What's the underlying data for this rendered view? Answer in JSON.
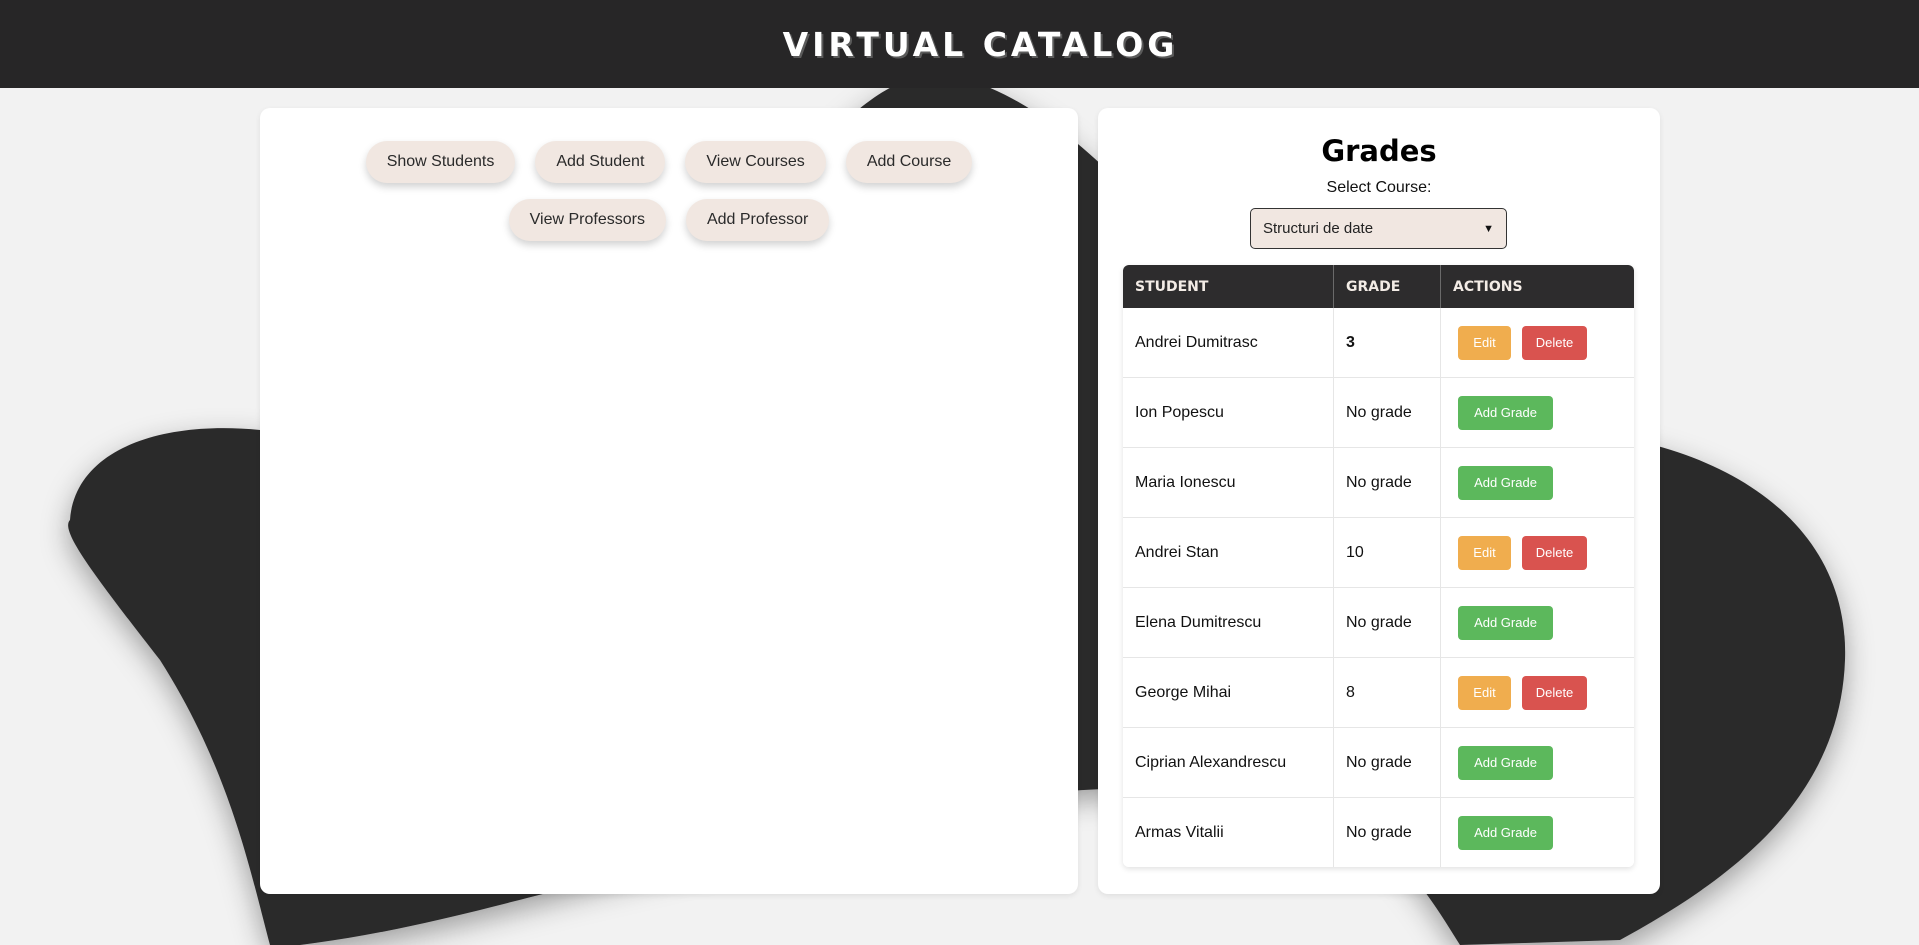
{
  "header": {
    "title": "VIRTUAL CATALOG"
  },
  "nav": {
    "row1": [
      "Show Students",
      "Add Student",
      "View Courses",
      "Add Course"
    ],
    "row2": [
      "View Professors",
      "Add Professor"
    ]
  },
  "grades": {
    "title": "Grades",
    "select_label": "Select Course:",
    "selected_course": "Structuri de date",
    "columns": [
      "STUDENT",
      "GRADE",
      "ACTIONS"
    ],
    "rows": [
      {
        "student": "Andrei Dumitrasc",
        "grade": "3",
        "actions": [
          "Edit",
          "Delete"
        ]
      },
      {
        "student": "Ion Popescu",
        "grade": "No grade",
        "actions": [
          "Add Grade"
        ]
      },
      {
        "student": "Maria Ionescu",
        "grade": "No grade",
        "actions": [
          "Add Grade"
        ]
      },
      {
        "student": "Andrei Stan",
        "grade": "10",
        "actions": [
          "Edit",
          "Delete"
        ]
      },
      {
        "student": "Elena Dumitrescu",
        "grade": "No grade",
        "actions": [
          "Add Grade"
        ]
      },
      {
        "student": "George Mihai",
        "grade": "8",
        "actions": [
          "Edit",
          "Delete"
        ]
      },
      {
        "student": "Ciprian Alexandrescu",
        "grade": "No grade",
        "actions": [
          "Add Grade"
        ]
      },
      {
        "student": "Armas Vitalii",
        "grade": "No grade",
        "actions": [
          "Add Grade"
        ]
      }
    ]
  },
  "colors": {
    "header_bg": "#272627",
    "page_bg": "#f2f2f2",
    "nav_button_bg": "#f1e7e1",
    "edit": "#f0ad4e",
    "delete": "#d9534f",
    "add": "#5cb85c",
    "low_grade": "#e2181f"
  }
}
